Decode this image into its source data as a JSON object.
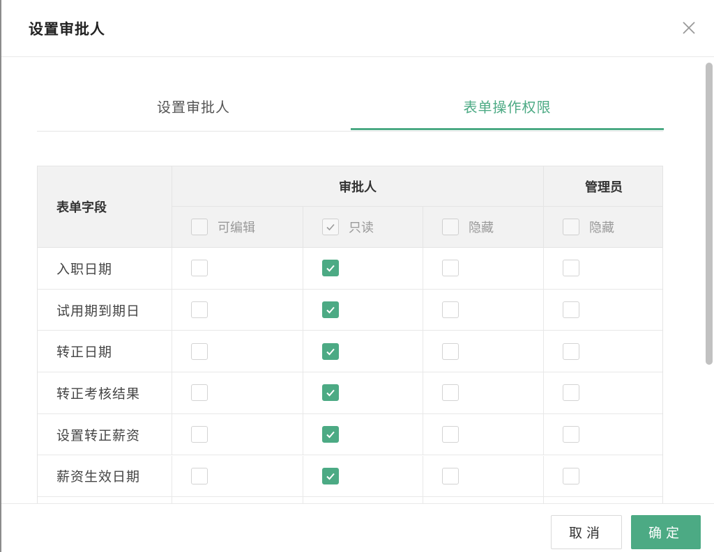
{
  "dialog": {
    "title": "设置审批人"
  },
  "tabs": [
    {
      "label": "设置审批人",
      "active": false
    },
    {
      "label": "表单操作权限",
      "active": true
    }
  ],
  "table": {
    "field_header": "表单字段",
    "group_approver": "审批人",
    "group_admin": "管理员",
    "sub_headers": [
      {
        "label": "可编辑",
        "checked": false
      },
      {
        "label": "只读",
        "checked": true
      },
      {
        "label": "隐藏",
        "checked": false
      },
      {
        "label": "隐藏",
        "checked": false
      }
    ],
    "rows": [
      {
        "field": "入职日期",
        "editable": false,
        "readonly": true,
        "hidden": false,
        "admin_hidden": false
      },
      {
        "field": "试用期到期日",
        "editable": false,
        "readonly": true,
        "hidden": false,
        "admin_hidden": false
      },
      {
        "field": "转正日期",
        "editable": false,
        "readonly": true,
        "hidden": false,
        "admin_hidden": false
      },
      {
        "field": "转正考核结果",
        "editable": false,
        "readonly": true,
        "hidden": false,
        "admin_hidden": false
      },
      {
        "field": "设置转正薪资",
        "editable": false,
        "readonly": true,
        "hidden": false,
        "admin_hidden": false
      },
      {
        "field": "薪资生效日期",
        "editable": false,
        "readonly": true,
        "hidden": false,
        "admin_hidden": false
      }
    ]
  },
  "footer": {
    "cancel_label": "取消",
    "ok_label": "确定"
  },
  "colors": {
    "accent": "#4caa84",
    "header_bg": "#f2f2f2",
    "border": "#e4e4e4"
  }
}
